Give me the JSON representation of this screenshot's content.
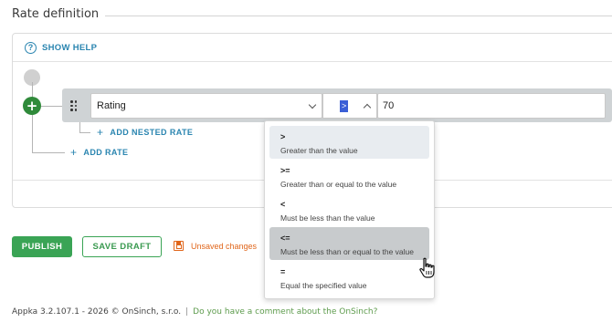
{
  "section": {
    "title": "Rate definition"
  },
  "help": {
    "icon": "help-circle-icon",
    "label": "SHOW HELP"
  },
  "rule": {
    "field_value": "Rating",
    "operator_value": ">",
    "input_value": "70"
  },
  "links": {
    "add_nested_rate": "ADD NESTED RATE",
    "add_rate": "ADD RATE"
  },
  "actions": {
    "publish": "PUBLISH",
    "save_draft": "SAVE DRAFT",
    "unsaved": "Unsaved changes"
  },
  "operator_options": [
    {
      "symbol": ">",
      "description": "Greater than the value",
      "state": "selected"
    },
    {
      "symbol": ">=",
      "description": "Greater than or equal to the value",
      "state": "normal"
    },
    {
      "symbol": "<",
      "description": "Must be less than the value",
      "state": "normal"
    },
    {
      "symbol": "<=",
      "description": "Must be less than or equal to the value",
      "state": "hover"
    },
    {
      "symbol": "=",
      "description": "Equal the specified value",
      "state": "normal"
    }
  ],
  "footer": {
    "version": "Appka 3.2.107.1 - 2026 © OnSinch, s.r.o.",
    "separator": "|",
    "feedback_link": "Do you have a comment about the OnSinch?"
  },
  "colors": {
    "accent_blue": "#2a85b0",
    "publish_green": "#3aa455",
    "warning_orange": "#e0661b"
  }
}
